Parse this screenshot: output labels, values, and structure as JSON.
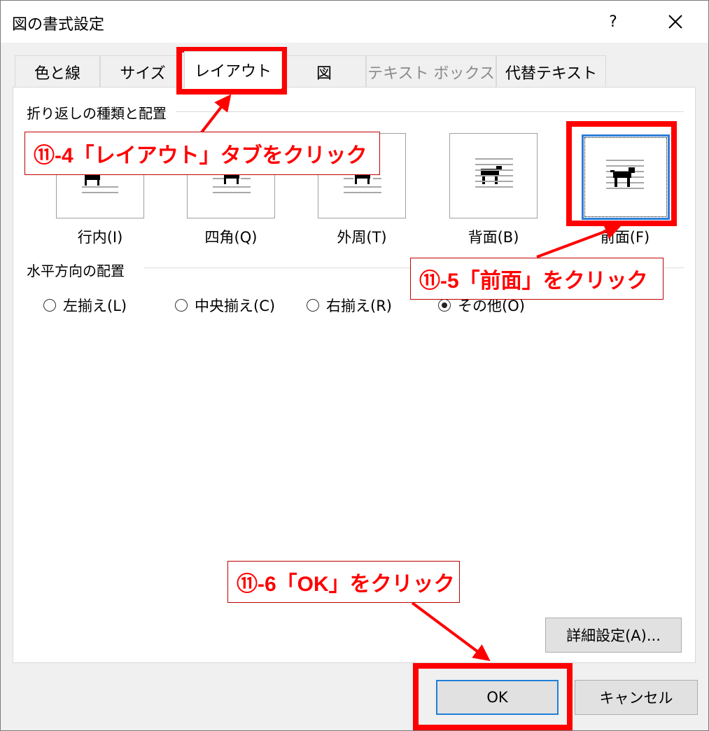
{
  "dialog": {
    "title": "図の書式設定",
    "help_label": "?"
  },
  "tabs": [
    {
      "label": "色と線"
    },
    {
      "label": "サイズ"
    },
    {
      "label": "レイアウト"
    },
    {
      "label": "図"
    },
    {
      "label": "テキスト ボックス"
    },
    {
      "label": "代替テキスト"
    }
  ],
  "wrap_section": {
    "label": "折り返しの種類と配置",
    "options": [
      {
        "label": "行内(I)"
      },
      {
        "label": "四角(Q)"
      },
      {
        "label": "外周(T)"
      },
      {
        "label": "背面(B)"
      },
      {
        "label": "前面(F)"
      }
    ],
    "selected": "前面(F)"
  },
  "horizontal_section": {
    "label": "水平方向の配置",
    "options": [
      {
        "label": "左揃え(L)",
        "checked": false
      },
      {
        "label": "中央揃え(C)",
        "checked": false
      },
      {
        "label": "右揃え(R)",
        "checked": false
      },
      {
        "label": "その他(O)",
        "checked": true
      }
    ]
  },
  "buttons": {
    "advanced": "詳細設定(A)...",
    "ok": "OK",
    "cancel": "キャンセル"
  },
  "annotations": {
    "step4": "⑪-4「レイアウト」タブをクリック",
    "step5": "⑪-5「前面」をクリック",
    "step6": "⑪-6「OK」をクリック"
  },
  "colors": {
    "highlight_red": "#ff0000",
    "selection_blue": "#2e7fd6"
  }
}
